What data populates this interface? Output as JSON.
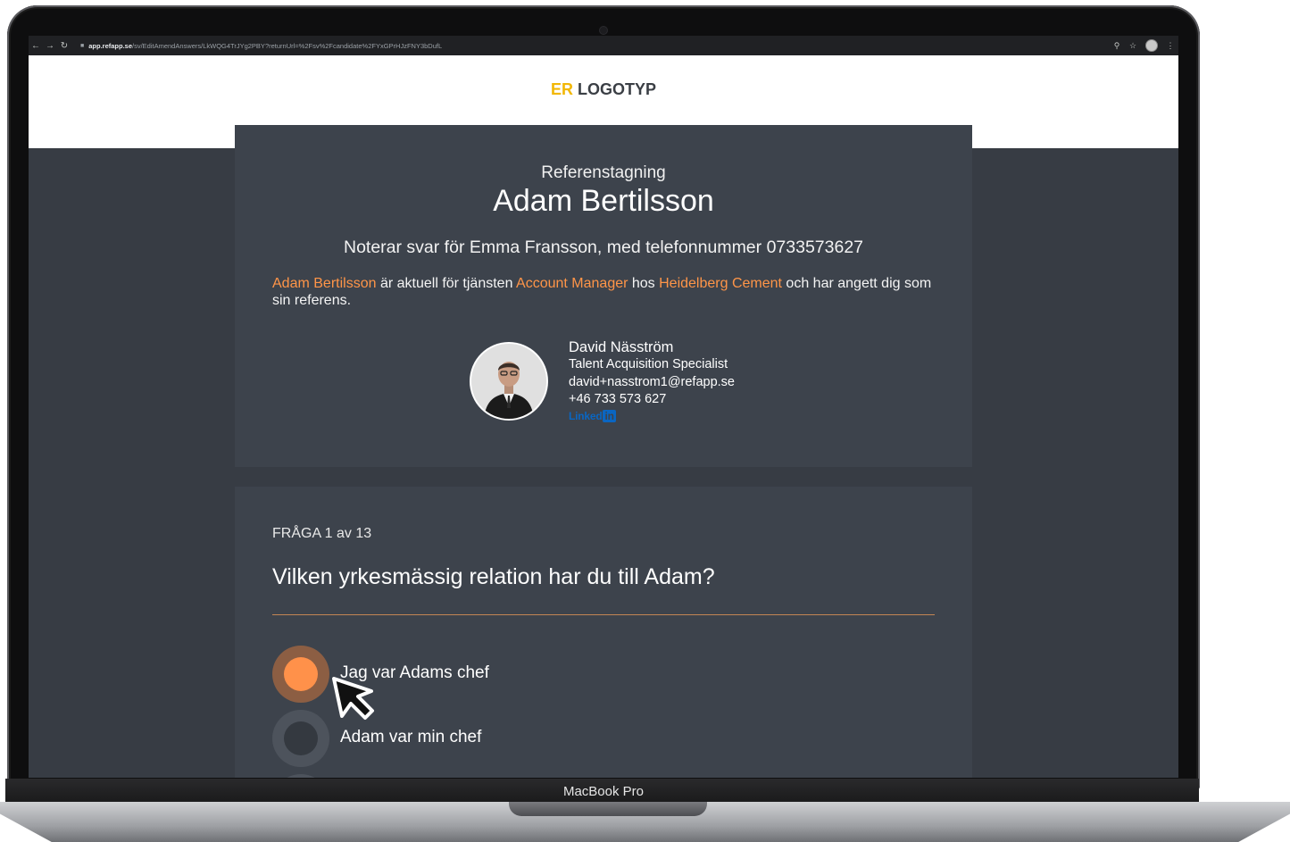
{
  "device": {
    "model_label": "MacBook Pro"
  },
  "browser": {
    "url_host": "app.refapp.se",
    "url_path": "/sv/EditAmendAnswers/LkWQG4TrJYg2PBY?returnUrl=%2Fsv%2Fcandidate%2FYxGPrHJzFNY3bDufL",
    "icons": [
      "back-icon",
      "forward-icon",
      "reload-icon",
      "lock-icon",
      "zoom-icon",
      "star-icon",
      "profile-icon",
      "menu-icon"
    ]
  },
  "header": {
    "logo_accent": "ER",
    "logo_text": "LOGOTYP"
  },
  "intro": {
    "kicker": "Referenstagning",
    "candidate_name": "Adam Bertilsson",
    "noting": "Noterar svar för Emma Fransson, med telefonnummer 0733573627",
    "text_part1": "Adam Bertilsson",
    "text_part2": " är aktuell för tjänsten ",
    "text_part3": "Account Manager",
    "text_part4": " hos ",
    "text_part5": "Heidelberg Cement",
    "text_part6": " och har angett dig som sin referens."
  },
  "recruiter": {
    "name": "David Näsström",
    "title": "Talent Acquisition Specialist",
    "email": "david+nasstrom1@refapp.se",
    "phone": "+46 733 573 627",
    "linkedin_text": "Linked",
    "linkedin_in": "in"
  },
  "question": {
    "counter": "FRÅGA 1 av 13",
    "text": "Vilken yrkesmässig relation har du till Adam?",
    "options": [
      {
        "label": "Jag var Adams chef",
        "selected": true
      },
      {
        "label": "Adam var min chef",
        "selected": false
      },
      {
        "label": "",
        "selected": false
      }
    ]
  },
  "colors": {
    "accent": "#ff914a",
    "logo_accent": "#f2b705",
    "card_bg": "#3d434c",
    "page_bg": "#373c44",
    "divider": "#c38554",
    "linkedin": "#0a66c2"
  }
}
